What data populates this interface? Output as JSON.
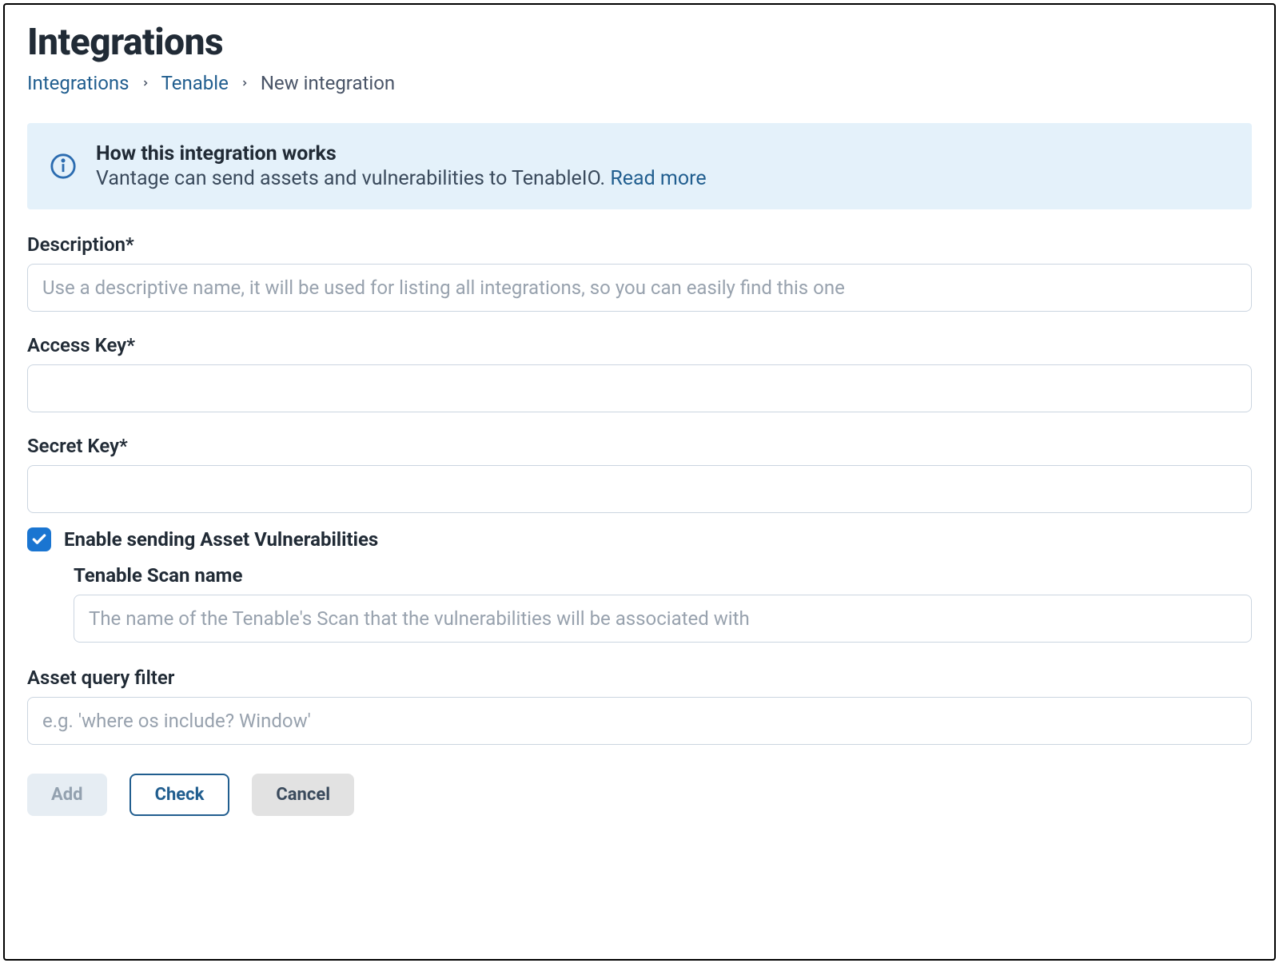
{
  "page": {
    "title": "Integrations"
  },
  "breadcrumb": {
    "items": [
      {
        "label": "Integrations",
        "link": true
      },
      {
        "label": "Tenable",
        "link": true
      },
      {
        "label": "New integration",
        "link": false
      }
    ]
  },
  "banner": {
    "title": "How this integration works",
    "description": "Vantage can send assets and vulnerabilities to TenableIO. ",
    "read_more": "Read more"
  },
  "form": {
    "description": {
      "label": "Description*",
      "placeholder": "Use a descriptive name, it will be used for listing all integrations, so you can easily find this one",
      "value": ""
    },
    "access_key": {
      "label": "Access Key*",
      "placeholder": "",
      "value": ""
    },
    "secret_key": {
      "label": "Secret Key*",
      "placeholder": "",
      "value": ""
    },
    "enable_vuln": {
      "label": "Enable sending Asset Vulnerabilities",
      "checked": true
    },
    "scan_name": {
      "label": "Tenable Scan name",
      "placeholder": "The name of the Tenable's Scan that the vulnerabilities will be associated with",
      "value": ""
    },
    "asset_query": {
      "label": "Asset query filter",
      "placeholder": "e.g. 'where os include? Window'",
      "value": ""
    }
  },
  "buttons": {
    "add": "Add",
    "check": "Check",
    "cancel": "Cancel"
  }
}
